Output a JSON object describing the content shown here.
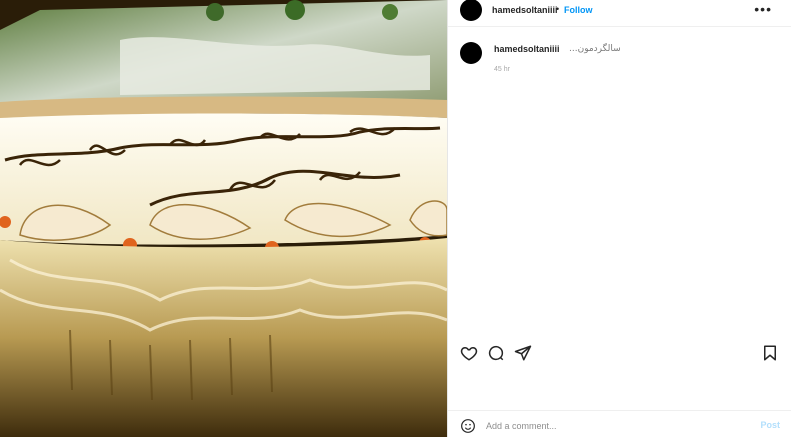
{
  "post": {
    "image_description": "",
    "cake_inscription_line1": "ساکلود اژدوانجیان",
    "cake_inscription_line2": "مبارک"
  },
  "header": {
    "username": "hamedsoltaniiii",
    "separator": "•",
    "follow_label": "Follow",
    "more_icon": "more-horizontal-icon"
  },
  "caption": {
    "username": "hamedsoltaniiii",
    "text": "سالگردمون...",
    "time": "45 hr"
  },
  "actions": {
    "like_icon": "heart-icon",
    "comment_icon": "comment-icon",
    "share_icon": "share-icon",
    "save_icon": "bookmark-icon"
  },
  "comment_box": {
    "emoji_icon": "emoji-icon",
    "placeholder": "Add a comment...",
    "post_label": "Post"
  },
  "colors": {
    "accent": "#0095f6",
    "post_disabled": "#b2dffc"
  }
}
